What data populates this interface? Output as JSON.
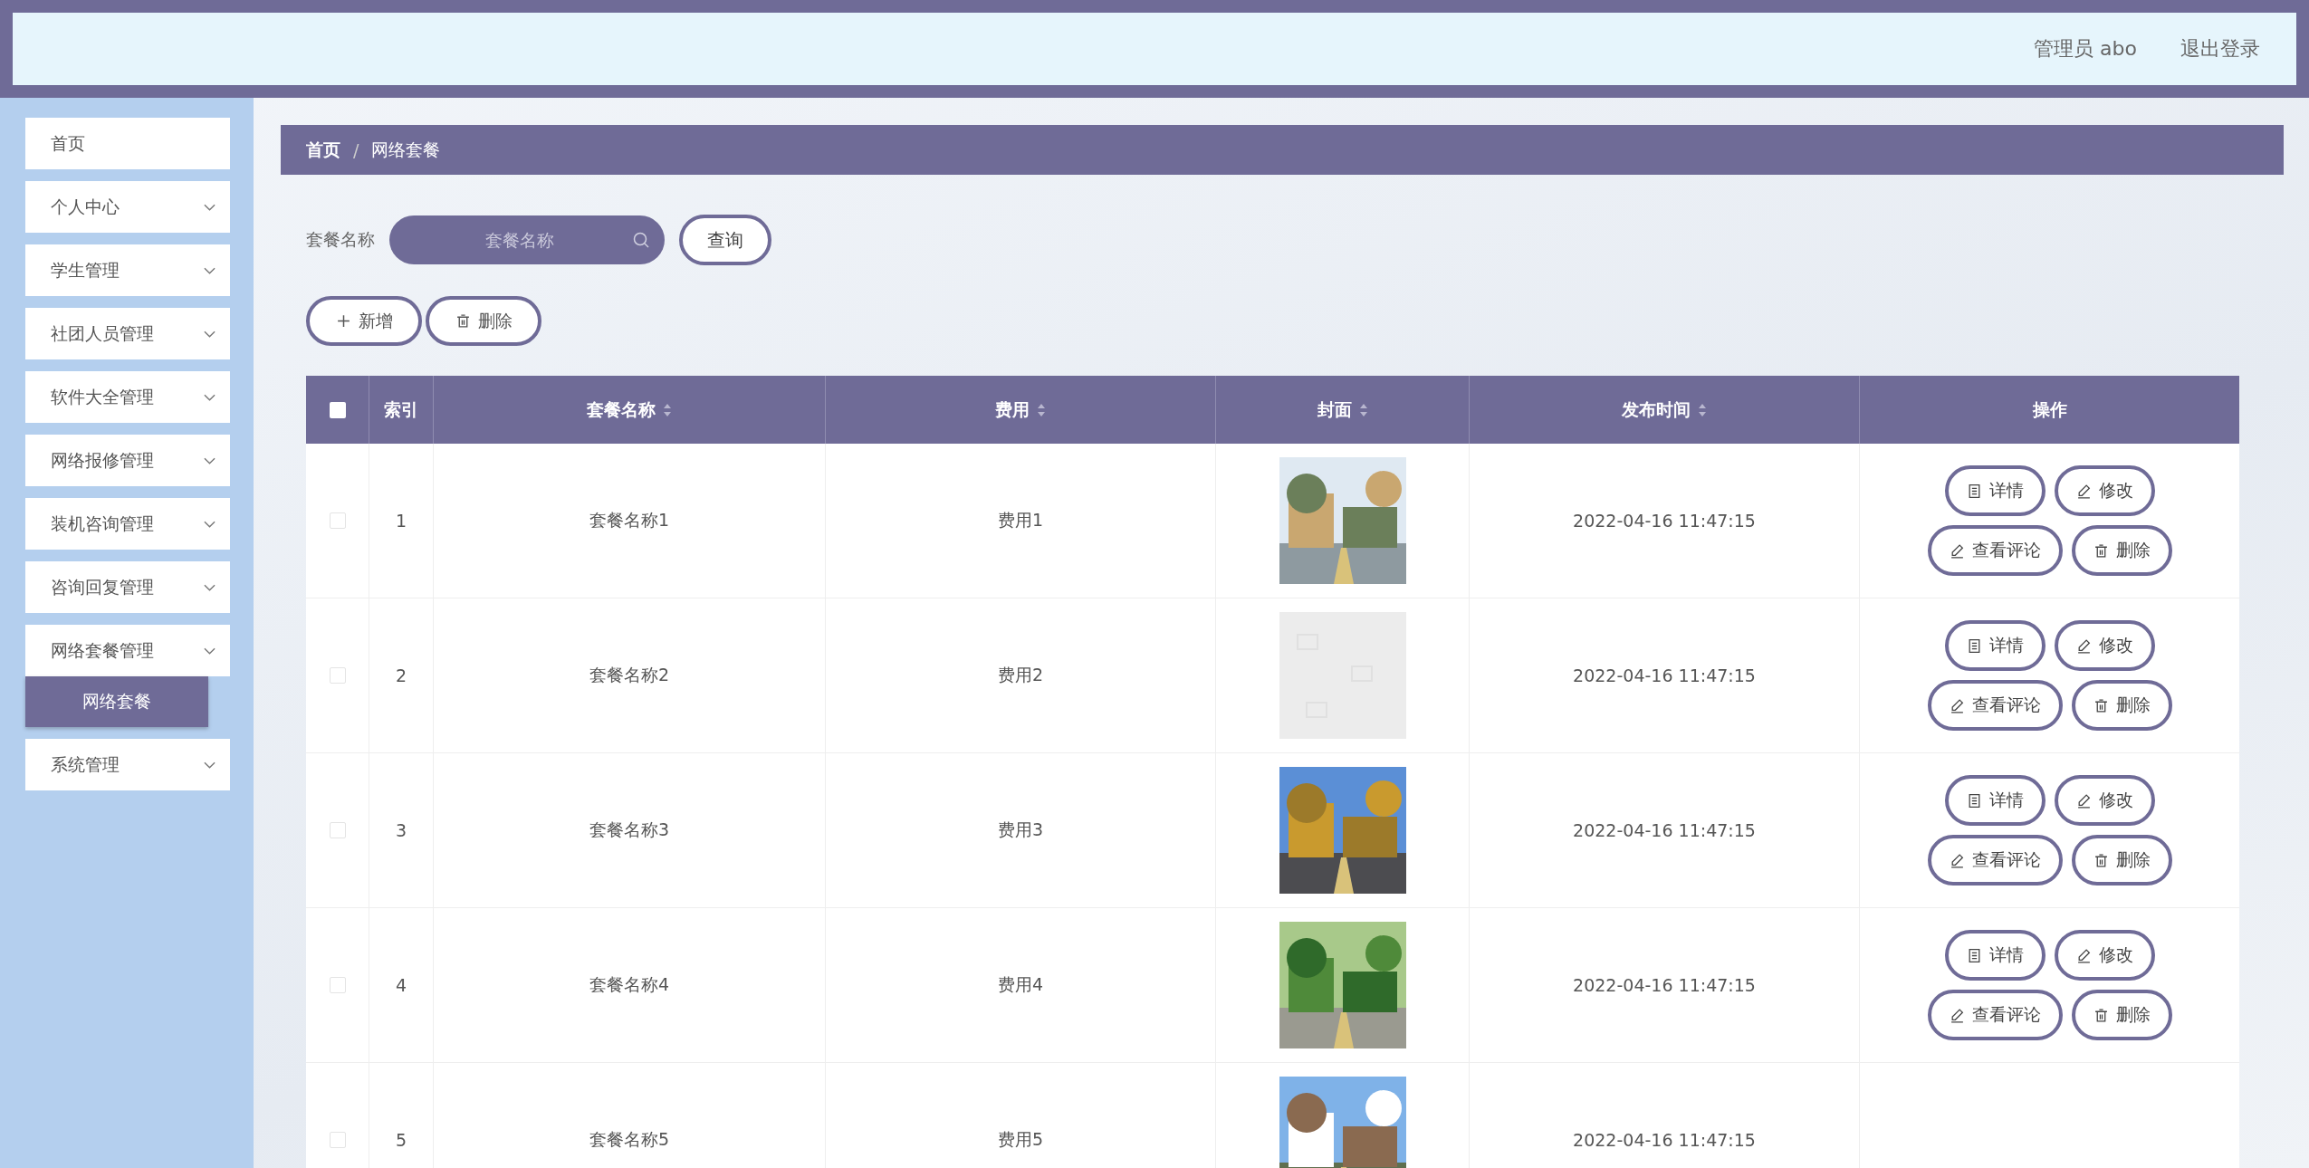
{
  "header": {
    "user": "管理员 abo",
    "logout": "退出登录"
  },
  "sidebar": {
    "items": [
      {
        "label": "首页",
        "kind": "link"
      },
      {
        "label": "个人中心",
        "kind": "submenu"
      },
      {
        "label": "学生管理",
        "kind": "submenu"
      },
      {
        "label": "社团人员管理",
        "kind": "submenu"
      },
      {
        "label": "软件大全管理",
        "kind": "submenu"
      },
      {
        "label": "网络报修管理",
        "kind": "submenu"
      },
      {
        "label": "装机咨询管理",
        "kind": "submenu"
      },
      {
        "label": "咨询回复管理",
        "kind": "submenu"
      },
      {
        "label": "网络套餐管理",
        "kind": "submenu",
        "children": [
          {
            "label": "网络套餐",
            "selected": true
          }
        ]
      },
      {
        "label": "系统管理",
        "kind": "submenu"
      }
    ]
  },
  "breadcrumb": [
    "首页",
    "网络套餐"
  ],
  "breadcrumb_separator": "/",
  "search": {
    "label": "套餐名称",
    "placeholder": "套餐名称",
    "button": "查询"
  },
  "toolbar": [
    "新增",
    "删除"
  ],
  "table": {
    "header_checked": false,
    "columns": [
      {
        "label": "索引",
        "sortable": false
      },
      {
        "label": "套餐名称",
        "sortable": true
      },
      {
        "label": "费用",
        "sortable": true
      },
      {
        "label": "封面",
        "sortable": true
      },
      {
        "label": "发布时间",
        "sortable": true
      },
      {
        "label": "操作",
        "sortable": false
      }
    ],
    "rows": [
      {
        "checked": false,
        "index": "1",
        "name": "套餐名称1",
        "fee": "费用1",
        "cover": {
          "kind": "picture"
        },
        "time": "2022-04-16 11:47:15",
        "actions": [
          "详情",
          "修改",
          "查看评论",
          "删除"
        ]
      },
      {
        "checked": false,
        "index": "2",
        "name": "套餐名称2",
        "fee": "费用2",
        "cover": {
          "kind": "placeholder"
        },
        "time": "2022-04-16 11:47:15",
        "actions": [
          "详情",
          "修改",
          "查看评论",
          "删除"
        ]
      },
      {
        "checked": false,
        "index": "3",
        "name": "套餐名称3",
        "fee": "费用3",
        "cover": {
          "kind": "picture"
        },
        "time": "2022-04-16 11:47:15",
        "actions": [
          "详情",
          "修改",
          "查看评论",
          "删除"
        ]
      },
      {
        "checked": false,
        "index": "4",
        "name": "套餐名称4",
        "fee": "费用4",
        "cover": {
          "kind": "picture"
        },
        "time": "2022-04-16 11:47:15",
        "actions": [
          "详情",
          "修改",
          "查看评论",
          "删除"
        ]
      },
      {
        "checked": false,
        "index": "5",
        "name": "套餐名称5",
        "fee": "费用5",
        "cover": {
          "kind": "picture"
        },
        "time": "2022-04-16 11:47:15"
      }
    ]
  }
}
